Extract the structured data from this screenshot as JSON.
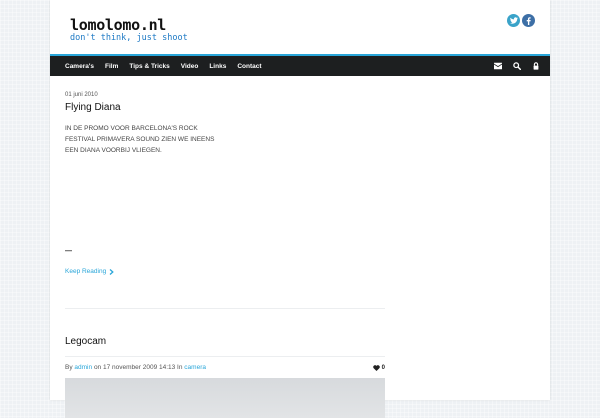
{
  "site": {
    "title": "lomolomo.nl",
    "tagline": "don't think, just shoot"
  },
  "social": {
    "twitter_color": "#3aa3c9",
    "facebook_color": "#3d6fa6"
  },
  "nav": {
    "items": [
      "Camera's",
      "Film",
      "Tips & Tricks",
      "Video",
      "Links",
      "Contact"
    ],
    "icons": [
      "envelope-icon",
      "search-icon",
      "lock-icon"
    ]
  },
  "colors": {
    "accent": "#29a6d9",
    "navbar": "#1d1f20"
  },
  "posts": [
    {
      "date": "01 juni 2010",
      "title": "Flying Diana",
      "excerpt": "IN DE PROMO VOOR BARCELONA'S ROCK FESTIVAL PRIMAVERA SOUND ZIEN WE INEENS EEN DIANA VOORBIJ VLIEGEN.",
      "dash": "—",
      "read_more": "Keep Reading"
    },
    {
      "title": "Legocam",
      "meta_prefix": "By",
      "author": "admin",
      "meta_middle": "on 17 november 2009 14:13 In",
      "category": "camera",
      "comments": "0"
    }
  ]
}
